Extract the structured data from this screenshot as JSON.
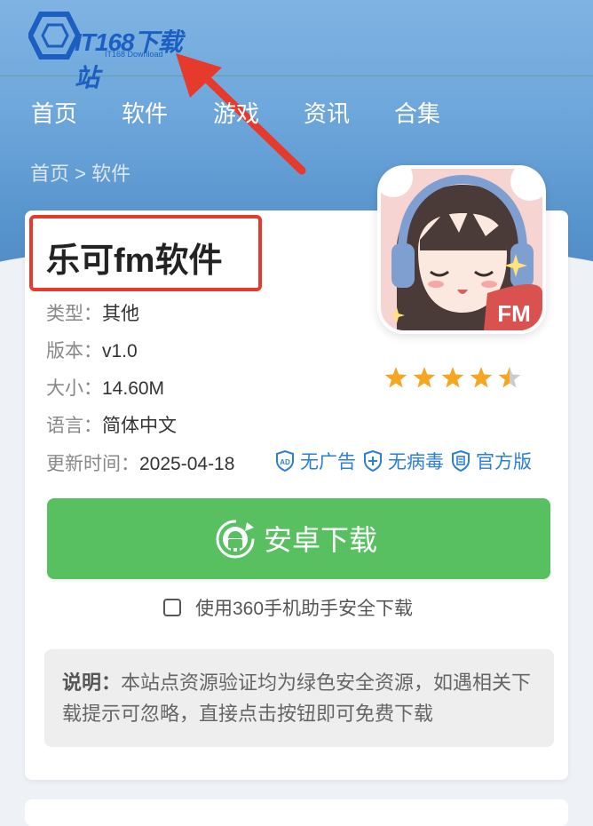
{
  "header": {
    "logo_text": "IT168下载站",
    "logo_subtext": "IT168 Download"
  },
  "nav": {
    "items": [
      "首页",
      "软件",
      "游戏",
      "资讯",
      "合集"
    ]
  },
  "breadcrumb": "首页 > 软件",
  "app": {
    "title": "乐可fm软件",
    "icon_badge_text": "FM",
    "rating": 4.5,
    "rating_max": 5,
    "info": [
      {
        "label": "类型：",
        "value": "其他"
      },
      {
        "label": "版本：",
        "value": "v1.0"
      },
      {
        "label": "大小：",
        "value": "14.60M"
      },
      {
        "label": "语言：",
        "value": "简体中文"
      },
      {
        "label": "更新时间：",
        "value": "2025-04-18"
      }
    ],
    "badges": [
      {
        "icon": "ad-shield-icon",
        "icon_text": "AD",
        "text": "无广告"
      },
      {
        "icon": "plus-shield-icon",
        "text": "无病毒"
      },
      {
        "icon": "official-shield-icon",
        "text": "官方版"
      }
    ]
  },
  "download": {
    "button_label": "安卓下载",
    "checkbox_label": "使用360手机助手安全下载",
    "checkbox_checked": false
  },
  "note": {
    "label": "说明：",
    "text": "本站点资源验证均为绿色安全资源，如遇相关下载提示可忽略，直接点击按钮即可免费下载"
  },
  "colors": {
    "accent_green": "#58c060",
    "link_blue": "#2b7fd6",
    "annotation_red": "#e53a2c",
    "star_orange": "#f5a623",
    "header_blue": "#6fa8dc"
  }
}
